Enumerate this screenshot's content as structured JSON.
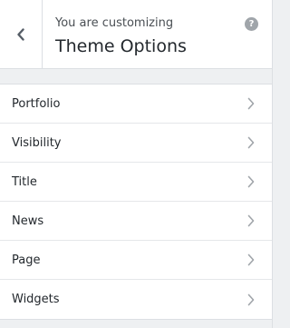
{
  "header": {
    "subtitle": "You are customizing",
    "title": "Theme Options",
    "help_glyph": "?"
  },
  "menu": {
    "items": [
      {
        "label": "Portfolio"
      },
      {
        "label": "Visibility"
      },
      {
        "label": "Title"
      },
      {
        "label": "News"
      },
      {
        "label": "Page"
      },
      {
        "label": "Widgets"
      }
    ]
  },
  "icons": {
    "back": "chevron-left-icon",
    "help": "help-icon",
    "item_arrow": "chevron-right-icon"
  },
  "colors": {
    "background": "#eef0f2",
    "panel": "#ffffff",
    "text": "#23282d",
    "icon": "#a0a5aa"
  }
}
